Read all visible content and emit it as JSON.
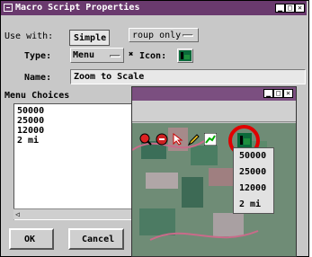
{
  "window": {
    "title": "Macro Script Properties"
  },
  "form": {
    "use_with_label": "Use with:",
    "use_with_popup": "Simple",
    "use_with_value": "roup only",
    "type_label": "Type:",
    "type_value": "Menu",
    "icon_checkbox": "✖",
    "icon_label": "Icon:",
    "name_label": "Name:",
    "name_value": "Zoom to Scale"
  },
  "menu_choices": {
    "heading": "Menu Choices",
    "items": [
      "50000",
      "25000",
      "12000",
      "2 mi"
    ]
  },
  "buttons": {
    "ok": "OK",
    "cancel": "Cancel"
  },
  "popup_menu": {
    "items": [
      "50000",
      "25000",
      "12000",
      "2 mi"
    ]
  }
}
